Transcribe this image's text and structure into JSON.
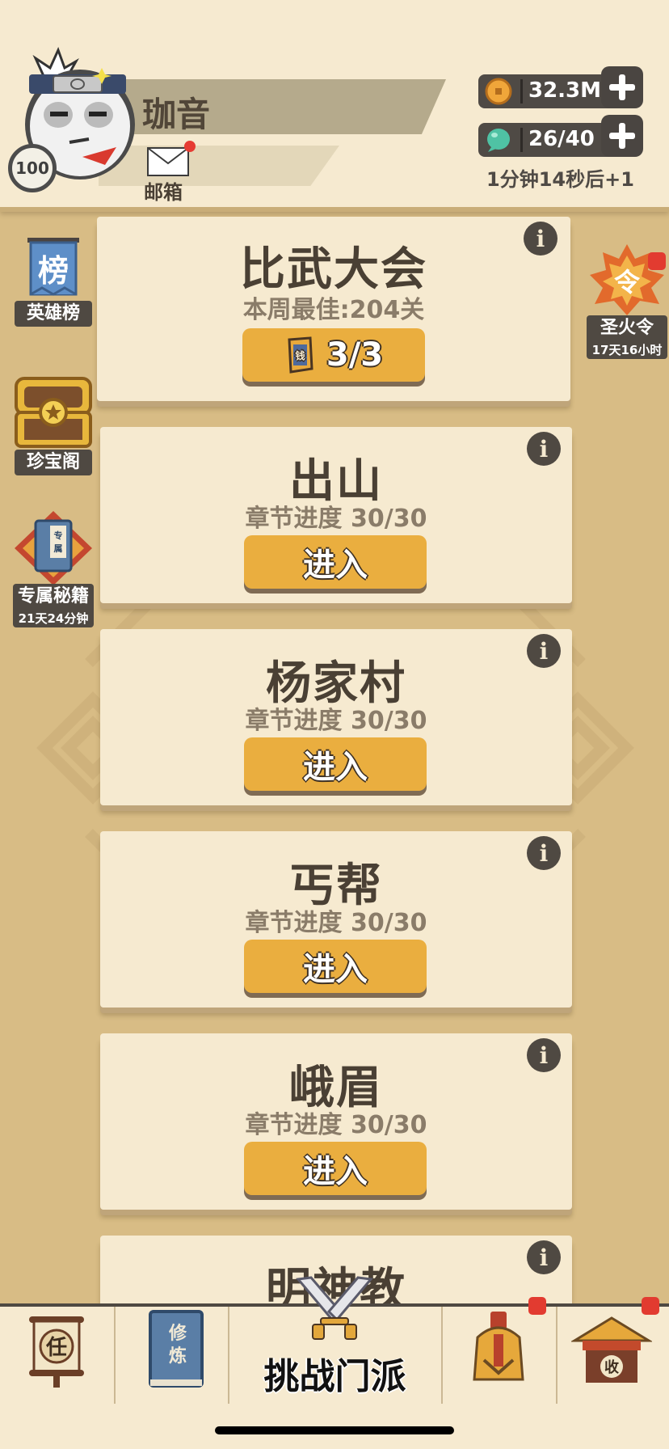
{
  "header": {
    "player_name": "珈音",
    "level": "100",
    "mail_label": "邮箱",
    "coins": "32.3M",
    "stamina": "26/40",
    "regen_text": "1分钟14秒后+1"
  },
  "side_left": [
    {
      "label": "英雄榜",
      "icon_text": "榜"
    },
    {
      "label": "珍宝阁"
    },
    {
      "label": "专属秘籍",
      "sub": "21天24分钟",
      "icon_text": "专属"
    }
  ],
  "side_right": {
    "label": "圣火令",
    "sub": "17天16小时",
    "icon_text": "令"
  },
  "arena": {
    "title": "比武大会",
    "best": "本周最佳:204关",
    "tickets": "3/3",
    "ticket_icon_text": "钱"
  },
  "stages": [
    {
      "title": "出山",
      "progress": "章节进度 30/30",
      "button": "进入"
    },
    {
      "title": "杨家村",
      "progress": "章节进度 30/30",
      "button": "进入"
    },
    {
      "title": "丐帮",
      "progress": "章节进度 30/30",
      "button": "进入"
    },
    {
      "title": "峨眉",
      "progress": "章节进度 30/30",
      "button": "进入"
    },
    {
      "title": "明神教"
    }
  ],
  "info_glyph": "i",
  "bottom_nav": {
    "task_icon_text": "任",
    "cultivate_icon_text": "修炼",
    "challenge_label": "挑战门派",
    "collect_icon_text": "收"
  },
  "colors": {
    "background": "#d8bc85",
    "card": "#f6ead0",
    "button": "#eaae3f",
    "dark": "#4f4942",
    "notify": "#e23b30"
  }
}
